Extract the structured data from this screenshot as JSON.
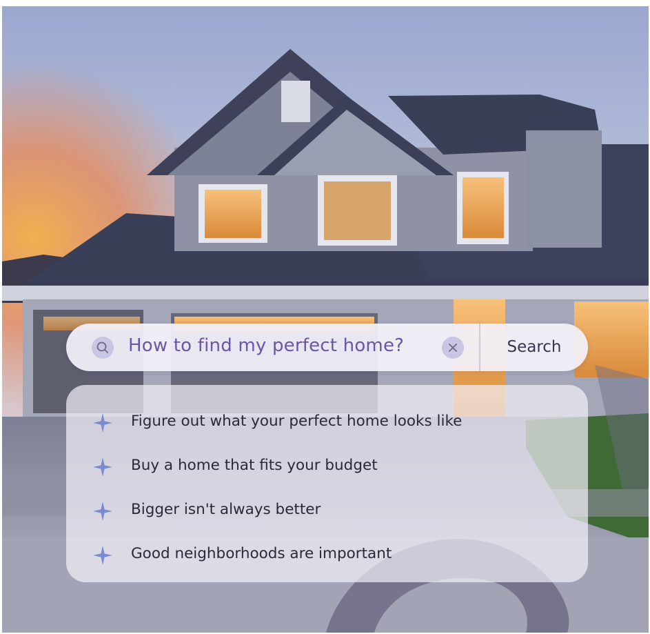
{
  "search": {
    "query": "How to find my perfect home?",
    "button_label": "Search",
    "search_icon": "search-icon",
    "clear_icon": "close-icon"
  },
  "suggestions": {
    "icon": "sparkle-icon",
    "items": [
      "Figure out what your perfect home looks like",
      "Buy a home that fits your budget",
      "Bigger isn't always better",
      "Good neighborhoods are important"
    ]
  },
  "colors": {
    "accent": "#6a55a8",
    "sparkle": "#7d8ad0",
    "icon_circle": "#c9c5e4"
  }
}
